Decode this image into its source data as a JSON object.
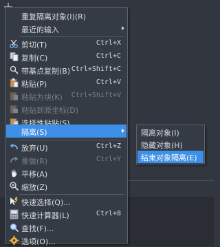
{
  "menu": {
    "items": [
      {
        "label": "重复隔离对象(I)(R)",
        "shortcut": "",
        "icon": "none"
      },
      {
        "label": "最近的输入",
        "shortcut": "",
        "icon": "none",
        "submenu": true
      },
      {
        "label": "剪切(T)",
        "shortcut": "Ctrl+X",
        "icon": "scissors-icon"
      },
      {
        "label": "复制(C)",
        "shortcut": "Ctrl+C",
        "icon": "copy-icon"
      },
      {
        "label": "带基点复制(B)",
        "shortcut": "Ctrl+Shift+C",
        "icon": "copy-base-icon"
      },
      {
        "label": "粘贴(P)",
        "shortcut": "Ctrl+V",
        "icon": "paste-icon"
      },
      {
        "label": "粘贴为块(K)",
        "shortcut": "Ctrl+Shift+V",
        "icon": "paste-block-icon",
        "disabled": true
      },
      {
        "label": "粘贴到原坐标(D)",
        "shortcut": "",
        "icon": "paste-orig-icon",
        "disabled": true
      },
      {
        "label": "选择性粘贴(S)...",
        "shortcut": "",
        "icon": "paste-special-icon"
      },
      {
        "label": "隔离(S)",
        "shortcut": "",
        "icon": "none",
        "submenu": true,
        "active": true
      },
      {
        "label": "放弃(U)",
        "shortcut": "Ctrl+Z",
        "icon": "undo-icon"
      },
      {
        "label": "重做(R)",
        "shortcut": "Ctrl+Y",
        "icon": "redo-icon",
        "disabled": true
      },
      {
        "label": "平移(A)",
        "shortcut": "",
        "icon": "pan-icon"
      },
      {
        "label": "缩放(Z)",
        "shortcut": "",
        "icon": "zoom-icon"
      },
      {
        "label": "快速选择(Q)...",
        "shortcut": "",
        "icon": "quick-select-icon"
      },
      {
        "label": "快速计算器(L)",
        "shortcut": "Ctrl+8",
        "icon": "calculator-icon"
      },
      {
        "label": "查找(F)...",
        "shortcut": "",
        "icon": "find-icon"
      },
      {
        "label": "选项(O)...",
        "shortcut": "",
        "icon": "options-icon"
      }
    ]
  },
  "submenu": {
    "items": [
      {
        "label": "隔离对象(I)"
      },
      {
        "label": "隐藏对象(H)"
      },
      {
        "label": "结束对象隔离(E)",
        "active": true
      }
    ]
  },
  "colors": {
    "accent": "#3d8fe8",
    "menu_bg": "#353b44",
    "page_bg": "#32373f"
  }
}
